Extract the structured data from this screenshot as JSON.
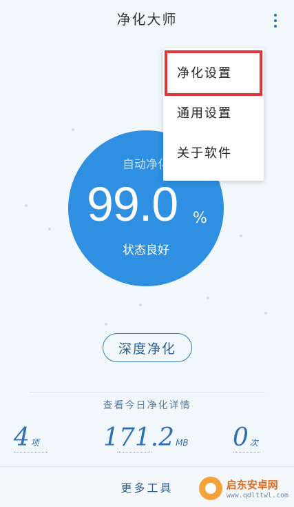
{
  "header": {
    "title": "净化大师",
    "menu_icon": "more-vertical-icon"
  },
  "gauge": {
    "label": "自动净化",
    "value": "99.0",
    "unit": "%",
    "status": "状态良好",
    "color": "#2f8fe0",
    "level_percent": 99.0
  },
  "actions": {
    "deep_clean_label": "深度净化"
  },
  "details": {
    "link_label": "查看今日净化详情"
  },
  "stats": [
    {
      "value": "4",
      "unit": "项"
    },
    {
      "value": "171.2",
      "unit": "MB"
    },
    {
      "value": "0",
      "unit": "次"
    }
  ],
  "bottom_bar": {
    "more_tools_label": "更多工具"
  },
  "menu": {
    "items": [
      {
        "label": "净化设置",
        "highlighted": true
      },
      {
        "label": "通用设置"
      },
      {
        "label": "关于软件"
      }
    ],
    "highlight_color": "#e0353b"
  },
  "watermark": {
    "name": "启东安卓网",
    "url": "www.qdlttwl.com"
  }
}
